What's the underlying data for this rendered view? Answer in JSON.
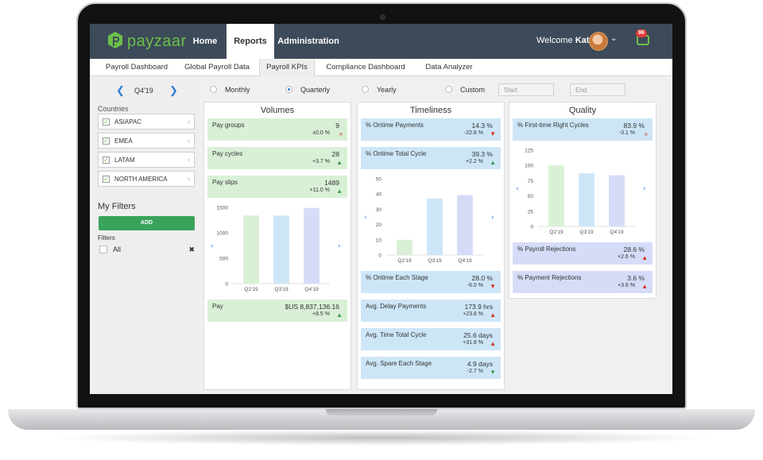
{
  "app": {
    "logo_text": "payzaar"
  },
  "nav": {
    "home": "Home",
    "reports": "Reports",
    "administration": "Administration"
  },
  "user": {
    "welcome": "Welcome",
    "name": "Kate",
    "notifications": "96"
  },
  "tabs": [
    "Payroll Dashboard",
    "Global Payroll Data",
    "Payroll KPIs",
    "Compliance Dashboard",
    "Data Analyzer"
  ],
  "period": {
    "current": "Q4'19"
  },
  "granularity": {
    "monthly": "Monthly",
    "quarterly": "Quarterly",
    "yearly": "Yearly",
    "custom": "Custom",
    "selected": "Quarterly"
  },
  "dates": {
    "start_placeholder": "Start",
    "end_placeholder": "End"
  },
  "sidebar": {
    "countries_label": "Countries",
    "countries": [
      "ASIAPAC",
      "EMEA",
      "LATAM",
      "NORTH AMERICA"
    ],
    "my_filters": "My Filters",
    "add": "ADD",
    "filters_label": "Filters",
    "all": "All"
  },
  "colors": {
    "green_card": "#d9f0d6",
    "blue_card": "#cde6f7",
    "purple_card": "#d6dcf8",
    "brand_green": "#6cc04a",
    "topbar": "#3d4a59",
    "add_button": "#3aa35b"
  },
  "volumes": {
    "title": "Volumes",
    "cards": [
      {
        "label": "Pay groups",
        "value": "9",
        "change": "±0.0 %",
        "trend": "flat"
      },
      {
        "label": "Pay cycles",
        "value": "28",
        "change": "+3.7 %",
        "trend": "up"
      },
      {
        "label": "Pay slips",
        "value": "1489",
        "change": "+11.0 %",
        "trend": "up"
      }
    ],
    "pay": {
      "label": "Pay",
      "value": "$US 8,837,136.16",
      "change": "+8.5 %",
      "trend": "up"
    }
  },
  "timeliness": {
    "title": "Timeliness",
    "cards_top": [
      {
        "label": "% Ontime Payments",
        "value": "14.3 %",
        "change": "-22.8 %",
        "trend": "down"
      },
      {
        "label": "% Ontime Total Cycle",
        "value": "39.3 %",
        "change": "+2.2 %",
        "trend": "up"
      }
    ],
    "cards_bottom": [
      {
        "label": "% Ontime Each Stage",
        "value": "28.0 %",
        "change": "-6.0 %",
        "trend": "down"
      },
      {
        "label": "Avg. Delay Payments",
        "value": "173.9 hrs",
        "change": "+23.8 %",
        "trend": "up-bad"
      },
      {
        "label": "Avg. Time Total Cycle",
        "value": "25.6 days",
        "change": "+31.8 %",
        "trend": "up-bad"
      },
      {
        "label": "Avg. Spare Each Stage",
        "value": "4.9 days",
        "change": "-2.7 %",
        "trend": "down-good"
      }
    ]
  },
  "quality": {
    "title": "Quality",
    "cards_top": [
      {
        "label": "% First-time Right Cycles",
        "value": "83.9 %",
        "change": "-3.1 %",
        "trend": "flat"
      }
    ],
    "cards_bottom": [
      {
        "label": "% Payroll Rejections",
        "value": "28.6 %",
        "change": "+2.6 %",
        "trend": "up-bad"
      },
      {
        "label": "% Payment Rejections",
        "value": "3.6 %",
        "change": "+3.6 %",
        "trend": "up-bad"
      }
    ]
  },
  "chart_data": [
    {
      "type": "bar",
      "categories": [
        "Q2'19",
        "Q3'19",
        "Q4'19"
      ],
      "values": [
        1340,
        1340,
        1489
      ],
      "ylim": [
        0,
        1500
      ],
      "yticks": [
        0,
        500,
        1000,
        1500
      ],
      "colors": [
        "#d9f0d6",
        "#cde6f7",
        "#d6dcf8"
      ],
      "grid": false
    },
    {
      "type": "bar",
      "categories": [
        "Q2'19",
        "Q3'19",
        "Q4'19"
      ],
      "values": [
        10,
        37,
        39.3
      ],
      "ylim": [
        0,
        50
      ],
      "yticks": [
        0,
        10,
        20,
        30,
        40,
        50
      ],
      "colors": [
        "#d9f0d6",
        "#cde6f7",
        "#d6dcf8"
      ],
      "grid": false
    },
    {
      "type": "bar",
      "categories": [
        "Q2'19",
        "Q3'19",
        "Q4'19"
      ],
      "values": [
        100,
        87,
        83.9
      ],
      "ylim": [
        0,
        125
      ],
      "yticks": [
        0,
        25,
        50,
        75,
        100,
        125
      ],
      "colors": [
        "#d9f0d6",
        "#cde6f7",
        "#d6dcf8"
      ],
      "grid": false
    }
  ]
}
